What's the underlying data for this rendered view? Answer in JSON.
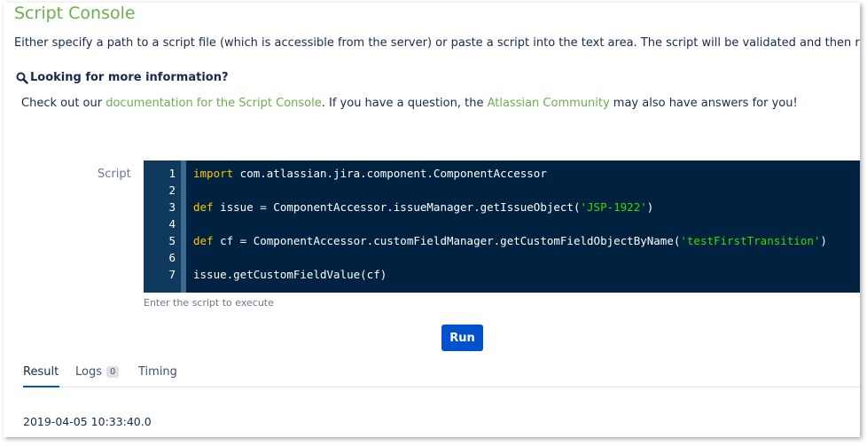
{
  "page": {
    "title": "Script Console",
    "intro": "Either specify a path to a script file (which is accessible from the server) or paste a script into the text area. The script will be validated and then run on the s"
  },
  "info": {
    "heading": "Looking for more information?",
    "text_before": "Check out our ",
    "doc_link": "documentation for the Script Console",
    "text_middle": ". If you have a question, the ",
    "community_link": "Atlassian Community",
    "text_after": " may also have answers for you!"
  },
  "editor": {
    "label": "Script",
    "hint": "Enter the script to execute",
    "line_numbers": [
      "1",
      "2",
      "3",
      "4",
      "5",
      "6",
      "7"
    ],
    "lines": [
      {
        "kw": "import",
        "rest": " com.atlassian.jira.component.ComponentAccessor",
        "str": "",
        "tail": ""
      },
      {
        "kw": "",
        "rest": "",
        "str": "",
        "tail": ""
      },
      {
        "kw": "def",
        "rest": " issue = ComponentAccessor.issueManager.getIssueObject(",
        "str": "'JSP-1922'",
        "tail": ")"
      },
      {
        "kw": "",
        "rest": "",
        "str": "",
        "tail": ""
      },
      {
        "kw": "def",
        "rest": " cf = ComponentAccessor.customFieldManager.getCustomFieldObjectByName(",
        "str": "'testFirstTransition'",
        "tail": ")"
      },
      {
        "kw": "",
        "rest": "",
        "str": "",
        "tail": ""
      },
      {
        "kw": "",
        "rest": "issue.getCustomFieldValue(cf)",
        "str": "",
        "tail": ""
      }
    ],
    "colors": {
      "background": "#002240",
      "keyword": "#ffc600",
      "string": "#3ad900"
    }
  },
  "actions": {
    "run_label": "Run"
  },
  "tabs": {
    "result": "Result",
    "logs": "Logs",
    "logs_count": "0",
    "timing": "Timing"
  },
  "result": {
    "value": "2019-04-05 10:33:40.0"
  },
  "icons": {
    "search": "magnifier-icon"
  }
}
